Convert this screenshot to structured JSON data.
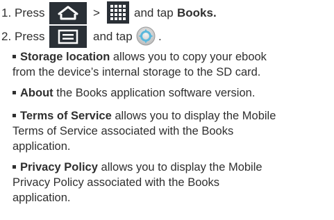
{
  "colors": {
    "text": "#2f2f2f",
    "icon_bg": "#2a3036",
    "gear": "#5bb8dc"
  },
  "step1": {
    "number": "1.",
    "press": "Press",
    "gt": ">",
    "and_tap": "and tap",
    "target": "Books."
  },
  "step2": {
    "number": "2.",
    "press": "Press",
    "and_tap": "and tap",
    "period": "."
  },
  "bullets": [
    {
      "bold": "Storage location",
      "lines": [
        "allows you to copy your ebook",
        "from the device’s internal storage to the SD card."
      ]
    },
    {
      "bold": "About",
      "lines": [
        "the Books application software version."
      ]
    },
    {
      "bold": "Terms of Service",
      "lines": [
        "allows you to display the Mobile",
        "Terms of Service associated with the Books",
        "application."
      ]
    },
    {
      "bold": "Privacy Policy",
      "lines": [
        "allows you to display the Mobile",
        "Privacy Policy associated with the Books",
        "application."
      ]
    }
  ],
  "icons": {
    "home": "home-icon",
    "apps": "apps-grid-icon",
    "menu": "menu-icon",
    "settings": "settings-gear-icon"
  }
}
